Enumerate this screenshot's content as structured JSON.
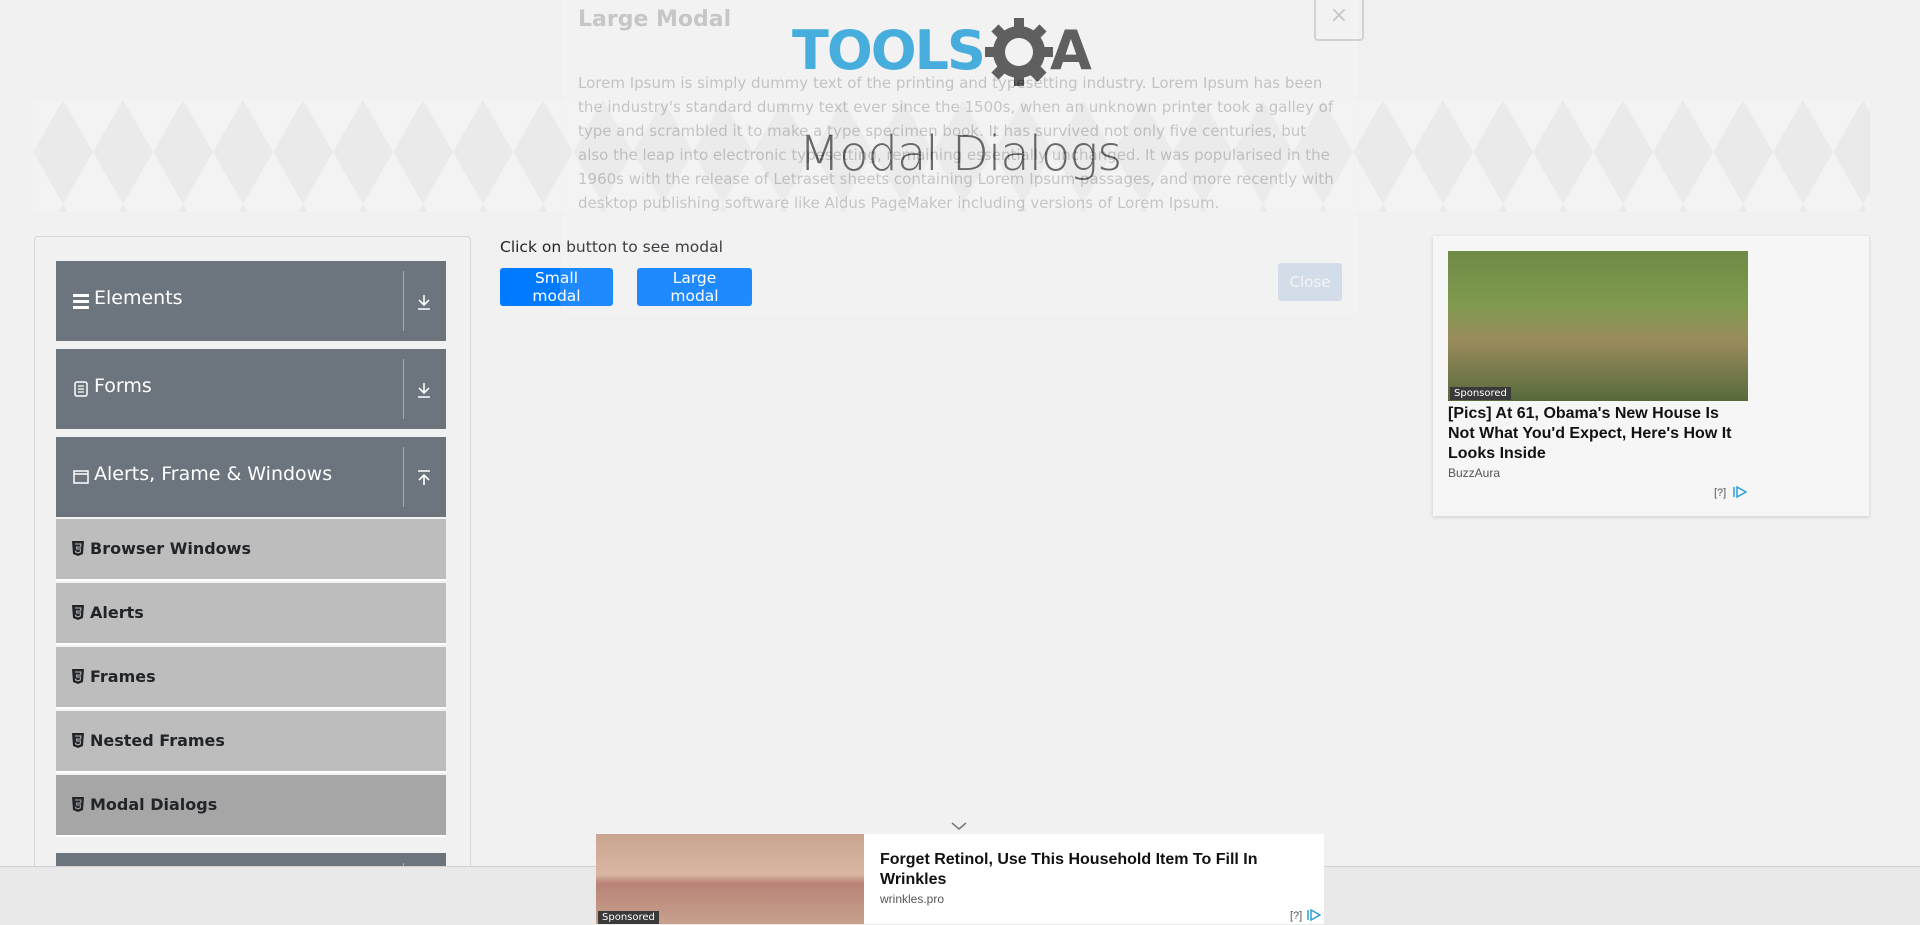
{
  "header": {
    "logo_text": "TOOLSQA",
    "page_title": "Modal Dialogs"
  },
  "sidebar": {
    "groups": [
      {
        "label": "Elements",
        "icon": "hamburger-icon",
        "arrow": "download-arrow-icon"
      },
      {
        "label": "Forms",
        "icon": "form-icon",
        "arrow": "download-arrow-icon"
      },
      {
        "label": "Alerts, Frame & Windows",
        "icon": "window-icon",
        "arrow": "upload-arrow-icon"
      }
    ],
    "items": [
      {
        "label": "Browser Windows",
        "icon": "html5-icon"
      },
      {
        "label": "Alerts",
        "icon": "html5-icon"
      },
      {
        "label": "Frames",
        "icon": "html5-icon"
      },
      {
        "label": "Nested Frames",
        "icon": "html5-icon"
      },
      {
        "label": "Modal Dialogs",
        "icon": "html5-icon",
        "active": true
      }
    ]
  },
  "main": {
    "instruction": "Click on button to see modal",
    "small_button": "Small modal",
    "large_button": "Large modal"
  },
  "modal": {
    "title": "Large Modal",
    "close_x": "×",
    "body": "Lorem Ipsum is simply dummy text of the printing and typesetting industry. Lorem Ipsum has been the industry's standard dummy text ever since the 1500s, when an unknown printer took a galley of type and scrambled it to make a type specimen book. It has survived not only five centuries, but also the leap into electronic typesetting, remaining essentially unchanged. It was popularised in the 1960s with the release of Letraset sheets containing Lorem Ipsum passages, and more recently with desktop publishing software like Aldus PageMaker including versions of Lorem Ipsum.",
    "close_button": "Close"
  },
  "ad_right": {
    "sponsored": "Sponsored",
    "title": "[Pics] At 61, Obama's New House Is Not What You'd Expect, Here's How It Looks Inside",
    "source": "BuzzAura",
    "info": "[?]"
  },
  "ad_bottom": {
    "sponsored": "Sponsored",
    "title": "Forget Retinol, Use This Household Item To Fill In Wrinkles",
    "source": "wrinkles.pro",
    "info": "[?]"
  },
  "colors": {
    "primary": "#007bff",
    "sidebar_group": "#6c757d",
    "sidebar_item": "#bdbdbd",
    "sidebar_item_active": "#a6a6a6",
    "logo_blue": "#2ea3d9",
    "logo_gray": "#4a4a4a"
  }
}
